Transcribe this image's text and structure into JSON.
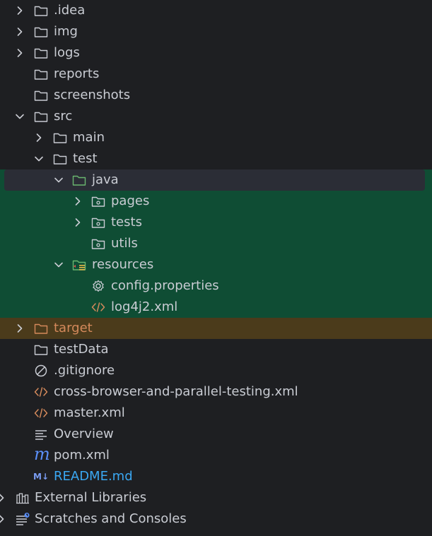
{
  "tree": [
    {
      "label": ".idea"
    },
    {
      "label": "img"
    },
    {
      "label": "logs"
    },
    {
      "label": "reports"
    },
    {
      "label": "screenshots"
    },
    {
      "label": "src"
    },
    {
      "label": "main"
    },
    {
      "label": "test"
    },
    {
      "label": "java"
    },
    {
      "label": "pages"
    },
    {
      "label": "tests"
    },
    {
      "label": "utils"
    },
    {
      "label": "resources"
    },
    {
      "label": "config.properties"
    },
    {
      "label": "log4j2.xml"
    },
    {
      "label": "target"
    },
    {
      "label": "testData"
    },
    {
      "label": ".gitignore"
    },
    {
      "label": "cross-browser-and-parallel-testing.xml"
    },
    {
      "label": "master.xml"
    },
    {
      "label": "Overview"
    },
    {
      "label": "pom.xml"
    },
    {
      "label": "README.md"
    },
    {
      "label": "External Libraries"
    },
    {
      "label": "Scratches and Consoles"
    }
  ],
  "colors": {
    "background": "#1e1f22",
    "source_root_highlight": "#0f4d34",
    "excluded_highlight": "#4b3b1b",
    "selection": "#2b2d36",
    "folder_icon": "#c9ccd3",
    "xml_icon": "#d4895b",
    "readme_text": "#3aa7f2",
    "maven_icon": "#5b8ff9"
  },
  "icons": {
    "folder": "folder-icon",
    "source_folder": "source-folder-icon",
    "package": "package-icon",
    "resources": "resources-folder-icon",
    "settings": "gear-icon",
    "xml": "xml-icon",
    "ignore": "ignore-icon",
    "text": "text-file-icon",
    "maven": "maven-icon",
    "markdown": "markdown-icon",
    "libraries": "libraries-icon",
    "scratches": "scratches-icon",
    "expand": "chevron-right-icon",
    "collapse": "chevron-down-icon"
  }
}
